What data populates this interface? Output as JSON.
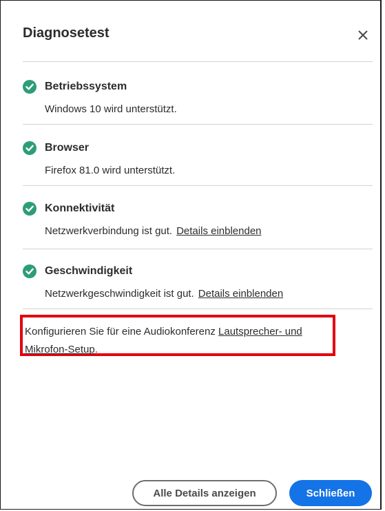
{
  "dialog": {
    "title": "Diagnosetest"
  },
  "checks": [
    {
      "title": "Betriebssystem",
      "status_text": "Windows 10 wird unterstützt.",
      "link": ""
    },
    {
      "title": "Browser",
      "status_text": "Firefox 81.0 wird unterstützt.",
      "link": ""
    },
    {
      "title": "Konnektivität",
      "status_text": "Netzwerkverbindung ist gut.",
      "link": "Details einblenden"
    },
    {
      "title": "Geschwindigkeit",
      "status_text": "Netzwerkgeschwindigkeit ist gut.",
      "link": "Details einblenden"
    }
  ],
  "audio": {
    "text": "Konfigurieren Sie für eine Audiokonferenz ",
    "link": "Lautsprecher- und Mikrofon-Setup",
    "suffix": "."
  },
  "footer": {
    "secondary_label": "Alle Details anzeigen",
    "primary_label": "Schließen"
  },
  "colors": {
    "accent": "#1473e6",
    "success": "#2d9d78",
    "highlight": "#e3000f"
  },
  "icons": {
    "close": "close-icon",
    "check": "checkmark-circle-icon"
  }
}
